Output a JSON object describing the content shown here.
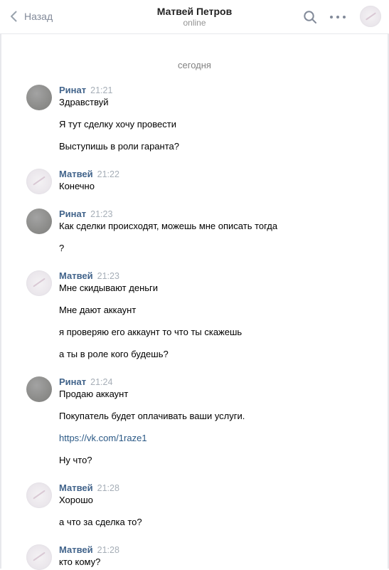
{
  "header": {
    "back_label": "Назад",
    "title": "Матвей Петров",
    "status": "online"
  },
  "date_separator": "сегодня",
  "groups": [
    {
      "author": "Ринат",
      "time": "21:21",
      "messages": [
        "Здравствуй",
        "Я тут сделку хочу провести",
        "Выступишь в роли гаранта?"
      ]
    },
    {
      "author": "Матвей",
      "time": "21:22",
      "messages": [
        "Конечно"
      ]
    },
    {
      "author": "Ринат",
      "time": "21:23",
      "messages": [
        "Как сделки происходят, можешь мне описать тогда",
        "?"
      ]
    },
    {
      "author": "Матвей",
      "time": "21:23",
      "messages": [
        "Мне скидывают деньги",
        "Мне дают аккаунт",
        "я проверяю его аккаунт то что ты скажешь",
        "а ты в роле кого будешь?"
      ]
    },
    {
      "author": "Ринат",
      "time": "21:24",
      "messages": [
        "Продаю аккаунт",
        "Покупатель будет оплачивать ваши услуги.",
        "https://vk.com/1raze1",
        "Ну что?"
      ]
    },
    {
      "author": "Матвей",
      "time": "21:28",
      "messages": [
        "Хорошо",
        "а что за сделка то?"
      ]
    },
    {
      "author": "Матвей",
      "time": "21:28",
      "messages": [
        "кто кому?"
      ]
    }
  ],
  "icons": {
    "back": "chevron-left-icon",
    "search": "search-icon",
    "more": "more-horizontal-icon"
  },
  "colors": {
    "author": "#42648b",
    "link": "#2a5885",
    "muted": "#828a99",
    "time": "#a6aeb7"
  }
}
